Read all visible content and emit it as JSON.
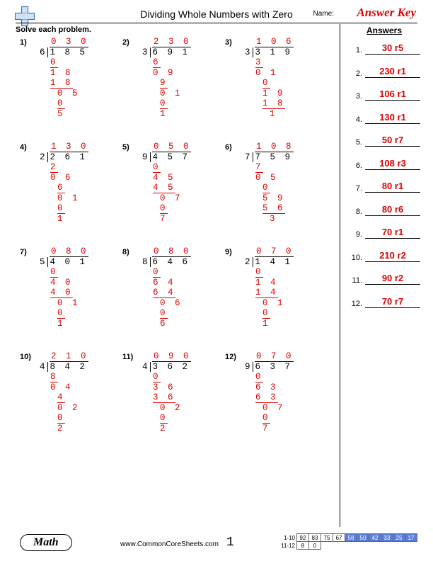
{
  "header": {
    "title": "Dividing Whole Numbers with Zero",
    "name_label": "Name:",
    "answer_key": "Answer Key"
  },
  "instruction": "Solve each problem.",
  "answers_header": "Answers",
  "problems": [
    {
      "n": "1)",
      "divisor": "6",
      "dividend": "1 8 5",
      "quotient": "0 3 0",
      "steps": [
        "0",
        "1 8",
        "1 8",
        "0 5",
        "0",
        "5"
      ],
      "ul": [
        true,
        false,
        true,
        false,
        true,
        false
      ],
      "pad": [
        0,
        0,
        0,
        1,
        1,
        1
      ]
    },
    {
      "n": "2)",
      "divisor": "3",
      "dividend": "6 9 1",
      "quotient": "2 3 0",
      "steps": [
        "6",
        "0 9",
        "9",
        "0 1",
        "0",
        "1"
      ],
      "ul": [
        true,
        false,
        true,
        false,
        true,
        false
      ],
      "pad": [
        0,
        0,
        1,
        1,
        1,
        1
      ]
    },
    {
      "n": "3)",
      "divisor": "3",
      "dividend": "3 1 9",
      "quotient": "1 0 6",
      "steps": [
        "3",
        "0 1",
        "0",
        "1 9",
        "1 8",
        "1"
      ],
      "ul": [
        true,
        false,
        true,
        false,
        true,
        false
      ],
      "pad": [
        0,
        0,
        1,
        1,
        1,
        2
      ]
    },
    {
      "n": "4)",
      "divisor": "2",
      "dividend": "2 6 1",
      "quotient": "1 3 0",
      "steps": [
        "2",
        "0 6",
        "6",
        "0 1",
        "0",
        "1"
      ],
      "ul": [
        true,
        false,
        true,
        false,
        true,
        false
      ],
      "pad": [
        0,
        0,
        1,
        1,
        1,
        1
      ]
    },
    {
      "n": "5)",
      "divisor": "9",
      "dividend": "4 5 7",
      "quotient": "0 5 0",
      "steps": [
        "0",
        "4 5",
        "4 5",
        "0 7",
        "0",
        "7"
      ],
      "ul": [
        true,
        false,
        true,
        false,
        true,
        false
      ],
      "pad": [
        0,
        0,
        0,
        1,
        1,
        1
      ]
    },
    {
      "n": "6)",
      "divisor": "7",
      "dividend": "7 5 9",
      "quotient": "1 0 8",
      "steps": [
        "7",
        "0 5",
        "0",
        "5 9",
        "5 6",
        "3"
      ],
      "ul": [
        true,
        false,
        true,
        false,
        true,
        false
      ],
      "pad": [
        0,
        0,
        1,
        1,
        1,
        2
      ]
    },
    {
      "n": "7)",
      "divisor": "5",
      "dividend": "4 0 1",
      "quotient": "0 8 0",
      "steps": [
        "0",
        "4 0",
        "4 0",
        "0 1",
        "0",
        "1"
      ],
      "ul": [
        true,
        false,
        true,
        false,
        true,
        false
      ],
      "pad": [
        0,
        0,
        0,
        1,
        1,
        1
      ]
    },
    {
      "n": "8)",
      "divisor": "8",
      "dividend": "6 4 6",
      "quotient": "0 8 0",
      "steps": [
        "0",
        "6 4",
        "6 4",
        "0 6",
        "0",
        "6"
      ],
      "ul": [
        true,
        false,
        true,
        false,
        true,
        false
      ],
      "pad": [
        0,
        0,
        0,
        1,
        1,
        1
      ]
    },
    {
      "n": "9)",
      "divisor": "2",
      "dividend": "1 4 1",
      "quotient": "0 7 0",
      "steps": [
        "0",
        "1 4",
        "1 4",
        "0 1",
        "0",
        "1"
      ],
      "ul": [
        true,
        false,
        true,
        false,
        true,
        false
      ],
      "pad": [
        0,
        0,
        0,
        1,
        1,
        1
      ]
    },
    {
      "n": "10)",
      "divisor": "4",
      "dividend": "8 4 2",
      "quotient": "2 1 0",
      "steps": [
        "8",
        "0 4",
        "4",
        "0 2",
        "0",
        "2"
      ],
      "ul": [
        true,
        false,
        true,
        false,
        true,
        false
      ],
      "pad": [
        0,
        0,
        1,
        1,
        1,
        1
      ]
    },
    {
      "n": "11)",
      "divisor": "4",
      "dividend": "3 6 2",
      "quotient": "0 9 0",
      "steps": [
        "0",
        "3 6",
        "3 6",
        "0 2",
        "0",
        "2"
      ],
      "ul": [
        true,
        false,
        true,
        false,
        true,
        false
      ],
      "pad": [
        0,
        0,
        0,
        1,
        1,
        1
      ]
    },
    {
      "n": "12)",
      "divisor": "9",
      "dividend": "6 3 7",
      "quotient": "0 7 0",
      "steps": [
        "0",
        "6 3",
        "6 3",
        "0 7",
        "0",
        "7"
      ],
      "ul": [
        true,
        false,
        true,
        false,
        true,
        false
      ],
      "pad": [
        0,
        0,
        0,
        1,
        1,
        1
      ]
    }
  ],
  "answers": [
    {
      "n": "1.",
      "v": "30 r5"
    },
    {
      "n": "2.",
      "v": "230 r1"
    },
    {
      "n": "3.",
      "v": "106 r1"
    },
    {
      "n": "4.",
      "v": "130 r1"
    },
    {
      "n": "5.",
      "v": "50 r7"
    },
    {
      "n": "6.",
      "v": "108 r3"
    },
    {
      "n": "7.",
      "v": "80 r1"
    },
    {
      "n": "8.",
      "v": "80 r6"
    },
    {
      "n": "9.",
      "v": "70 r1"
    },
    {
      "n": "10.",
      "v": "210 r2"
    },
    {
      "n": "11.",
      "v": "90 r2"
    },
    {
      "n": "12.",
      "v": "70 r7"
    }
  ],
  "footer": {
    "subject": "Math",
    "url": "www.CommonCoreSheets.com",
    "page": "1",
    "score_rows": [
      {
        "label": "1-10",
        "cells": [
          "92",
          "83",
          "75",
          "67",
          "58",
          "50",
          "42",
          "33",
          "25",
          "17"
        ],
        "hi": 4
      },
      {
        "label": "11-12",
        "cells": [
          "8",
          "0"
        ],
        "hi": 2
      }
    ]
  }
}
